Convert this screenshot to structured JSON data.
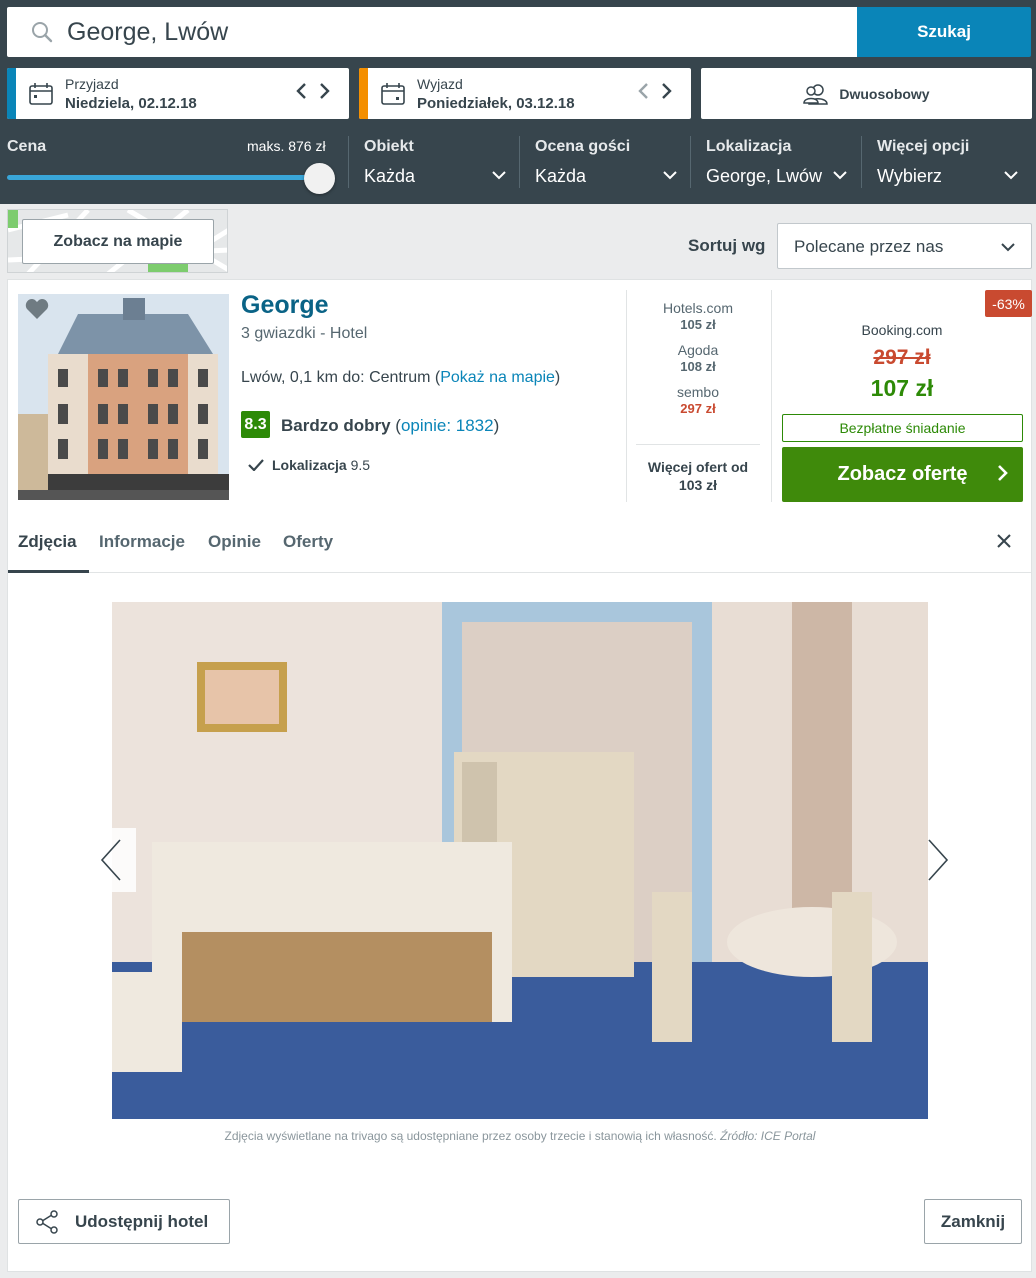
{
  "search": {
    "value": "George, Lwów",
    "button": "Szukaj"
  },
  "checkin": {
    "label": "Przyjazd",
    "date": "Niedziela, 02.12.18",
    "accent": "#0a85b8"
  },
  "checkout": {
    "label": "Wyjazd",
    "date": "Poniedziałek, 03.12.18",
    "accent": "#f48f00"
  },
  "room": {
    "label": "Dwuosobowy"
  },
  "filters": {
    "price": {
      "label": "Cena",
      "max": "maks. 876 zł",
      "level": 1.0
    },
    "object": {
      "label": "Obiekt",
      "value": "Każda"
    },
    "rating": {
      "label": "Ocena gości",
      "value": "Każda"
    },
    "location": {
      "label": "Lokalizacja",
      "value": "George, Lwów"
    },
    "more": {
      "label": "Więcej opcji",
      "value": "Wybierz"
    }
  },
  "map_button": "Zobacz na mapie",
  "sort": {
    "label": "Sortuj wg",
    "value": "Polecane przez nas"
  },
  "hotel": {
    "name": "George",
    "stars_type": "3 gwiazdki -  Hotel",
    "location_text": "Lwów, 0,1 km do: Centrum (",
    "map_link": "Pokaż na mapie",
    "location_close": ")",
    "score": "8.3",
    "score_label": "Bardzo dobry",
    "reviews_open": " (",
    "reviews_link": "opinie: 1832",
    "reviews_close": ")",
    "sub_rating_label": "Lokalizacja",
    "sub_rating_value": "9.5"
  },
  "other_prices": [
    {
      "site": "Hotels.com",
      "price": "105 zł",
      "highlight": false
    },
    {
      "site": "Agoda",
      "price": "108 zł",
      "highlight": false
    },
    {
      "site": "sembo",
      "price": "297 zł",
      "highlight": true
    }
  ],
  "more_offers": {
    "line1": "Więcej ofert od",
    "line2": "103 zł"
  },
  "deal": {
    "discount": "-63%",
    "partner": "Booking.com",
    "old_price": "297 zł",
    "new_price": "107 zł",
    "perk": "Bezpłatne śniadanie",
    "button": "Zobacz ofertę"
  },
  "tabs": [
    "Zdjęcia",
    "Informacje",
    "Opinie",
    "Oferty"
  ],
  "caption": {
    "text": "Zdjęcia wyświetlane na trivago są udostępniane przez osoby trzecie i stanowią ich własność. ",
    "source": "Źródło: ICE Portal"
  },
  "share_button": "Udostępnij hotel",
  "close_button": "Zamknij",
  "colors": {
    "header_bg": "#37454d",
    "primary": "#0a85b8",
    "green": "#2d8a07",
    "red": "#c94a30"
  }
}
